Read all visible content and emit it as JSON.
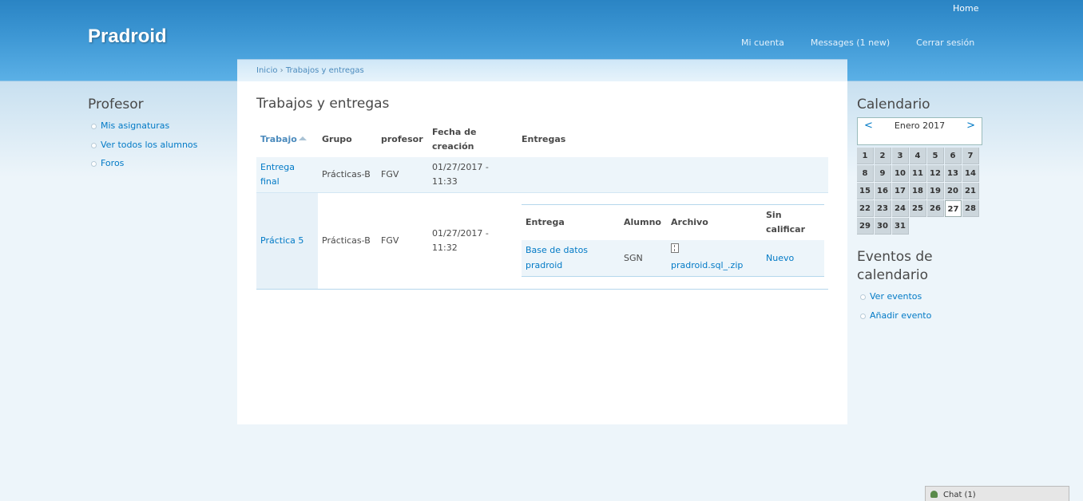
{
  "site": {
    "name": "Pradroid",
    "top_link": "Home"
  },
  "primary_links": [
    "Mi cuenta",
    "Messages (1 new)",
    "Cerrar sesión"
  ],
  "breadcrumb": {
    "home": "Inicio",
    "separator": "›",
    "current": "Trabajos y entregas"
  },
  "page_title": "Trabajos y entregas",
  "left_sidebar": {
    "title": "Profesor",
    "items": [
      "Mis asignaturas",
      "Ver todos los alumnos",
      "Foros"
    ]
  },
  "table": {
    "headers": {
      "trabajo": "Trabajo",
      "grupo": "Grupo",
      "profesor": "profesor",
      "fecha": "Fecha de creación",
      "entregas": "Entregas"
    },
    "rows": [
      {
        "trabajo": "Entrega final",
        "grupo": "Prácticas-B",
        "profesor": "FGV",
        "fecha": "01/27/2017 - 11:33"
      },
      {
        "trabajo": "Práctica 5",
        "grupo": "Prácticas-B",
        "profesor": "FGV",
        "fecha": "01/27/2017 - 11:32"
      }
    ],
    "inner": {
      "headers": {
        "entrega": "Entrega",
        "alumno": "Alumno",
        "archivo": "Archivo",
        "sin_calificar": "Sin calificar"
      },
      "row": {
        "entrega": "Base de datos pradroid",
        "alumno": "SGN",
        "archivo": "pradroid.sql_.zip",
        "estado": "Nuevo"
      }
    }
  },
  "calendar": {
    "title": "Calendario",
    "month": "Enero 2017",
    "prev": "<",
    "next": ">",
    "today": 27,
    "days": [
      "1",
      "2",
      "3",
      "4",
      "5",
      "6",
      "7",
      "8",
      "9",
      "10",
      "11",
      "12",
      "13",
      "14",
      "15",
      "16",
      "17",
      "18",
      "19",
      "20",
      "21",
      "22",
      "23",
      "24",
      "25",
      "26",
      "27",
      "28",
      "29",
      "30",
      "31"
    ]
  },
  "events": {
    "title": "Eventos de calendario",
    "items": [
      "Ver eventos",
      "Añadir evento"
    ]
  },
  "chat": {
    "label": "Chat (1)"
  }
}
